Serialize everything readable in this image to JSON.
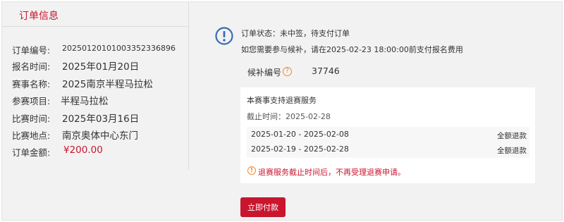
{
  "order_info": {
    "title": "订单信息",
    "fields": [
      {
        "label": "订单编号:",
        "value": "20250120101003352336896"
      },
      {
        "label": "报名时间:",
        "value": "2025年01月20日"
      },
      {
        "label": "赛事名称:",
        "value": "2025南京半程马拉松"
      },
      {
        "label": "参赛项目:",
        "value": "半程马拉松"
      },
      {
        "label": "比赛时间:",
        "value": "2025年03月16日"
      },
      {
        "label": "比赛地点:",
        "value": "南京奥体中心东门"
      },
      {
        "label": "订单金额:",
        "value": "¥200.00"
      }
    ]
  },
  "status": {
    "icon": "info-circle-icon",
    "line1": "订单状态：未中签，待支付订单",
    "line2": "如您需要参与候补，请在2025-02-23 18:00:00前支付报名费用"
  },
  "waitlist": {
    "label": "候补编号",
    "help_icon": "?",
    "value": "37746"
  },
  "refund": {
    "title": "本赛事支持退赛服务",
    "deadline": "截止时间：2025-02-28",
    "rows": [
      {
        "range": "2025-01-20 - 2025-02-08",
        "type": "全额退款"
      },
      {
        "range": "2025-02-19 - 2025-02-28",
        "type": "全额退款"
      }
    ],
    "warn_icon": "!",
    "note": "退赛服务截止时间后，不再受理退赛申请。"
  },
  "actions": {
    "pay_label": "立即付款"
  },
  "colors": {
    "accent": "#c9152e",
    "status_blue": "#3b6bb5",
    "warning_orange": "#f08c2e",
    "background": "#f2f2f2"
  }
}
